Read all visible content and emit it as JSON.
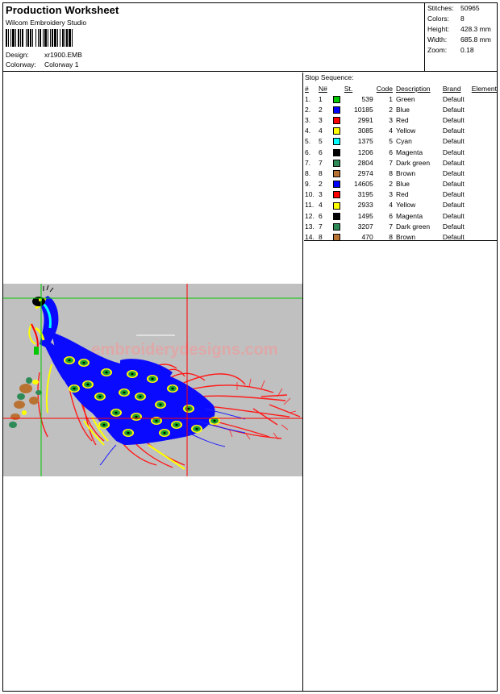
{
  "header": {
    "title": "Production Worksheet",
    "app": "Wilcom  Embroidery Studio",
    "design_label": "Design:",
    "design_value": "xr1900.EMB",
    "colorway_label": "Colorway:",
    "colorway_value": "Colorway 1"
  },
  "stats": [
    {
      "label": "Stitches:",
      "value": "50965"
    },
    {
      "label": "Colors:",
      "value": "8"
    },
    {
      "label": "Height:",
      "value": "428.3 mm"
    },
    {
      "label": "Width:",
      "value": "685.8 mm"
    },
    {
      "label": "Zoom:",
      "value": "0.18"
    }
  ],
  "stop_sequence": {
    "title": "Stop Sequence:",
    "columns": [
      "#",
      "N#",
      "",
      "St.",
      "Code",
      "Description",
      "Brand",
      "Element"
    ],
    "rows": [
      {
        "idx": "1.",
        "n": "1",
        "color": "#00c800",
        "st": "539",
        "code": "1",
        "desc": "Green",
        "brand": "Default"
      },
      {
        "idx": "2.",
        "n": "2",
        "color": "#0000ff",
        "st": "10185",
        "code": "2",
        "desc": "Blue",
        "brand": "Default"
      },
      {
        "idx": "3.",
        "n": "3",
        "color": "#ff0000",
        "st": "2991",
        "code": "3",
        "desc": "Red",
        "brand": "Default"
      },
      {
        "idx": "4.",
        "n": "4",
        "color": "#ffff00",
        "st": "3085",
        "code": "4",
        "desc": "Yellow",
        "brand": "Default"
      },
      {
        "idx": "5.",
        "n": "5",
        "color": "#00ffff",
        "st": "1375",
        "code": "5",
        "desc": "Cyan",
        "brand": "Default"
      },
      {
        "idx": "6.",
        "n": "6",
        "color": "#000000",
        "st": "1206",
        "code": "6",
        "desc": "Magenta",
        "brand": "Default"
      },
      {
        "idx": "7.",
        "n": "7",
        "color": "#2e8b57",
        "st": "2804",
        "code": "7",
        "desc": "Dark green",
        "brand": "Default"
      },
      {
        "idx": "8.",
        "n": "8",
        "color": "#b87333",
        "st": "2974",
        "code": "8",
        "desc": "Brown",
        "brand": "Default"
      },
      {
        "idx": "9.",
        "n": "2",
        "color": "#0000ff",
        "st": "14605",
        "code": "2",
        "desc": "Blue",
        "brand": "Default"
      },
      {
        "idx": "10.",
        "n": "3",
        "color": "#ff0000",
        "st": "3195",
        "code": "3",
        "desc": "Red",
        "brand": "Default"
      },
      {
        "idx": "11.",
        "n": "4",
        "color": "#ffff00",
        "st": "2933",
        "code": "4",
        "desc": "Yellow",
        "brand": "Default"
      },
      {
        "idx": "12.",
        "n": "6",
        "color": "#000000",
        "st": "1495",
        "code": "6",
        "desc": "Magenta",
        "brand": "Default"
      },
      {
        "idx": "13.",
        "n": "7",
        "color": "#2e8b57",
        "st": "3207",
        "code": "7",
        "desc": "Dark green",
        "brand": "Default"
      },
      {
        "idx": "14.",
        "n": "8",
        "color": "#b87333",
        "st": "470",
        "code": "8",
        "desc": "Brown",
        "brand": "Default"
      }
    ]
  },
  "preview": {
    "watermark": "embroiderydesigns.com",
    "background": "#c0c0c0",
    "crosshair_colors": {
      "vertical_left": "#00c800",
      "horizontal_top": "#00c800",
      "vertical_right": "#ff0000",
      "horizontal_bottom": "#ff0000"
    }
  }
}
